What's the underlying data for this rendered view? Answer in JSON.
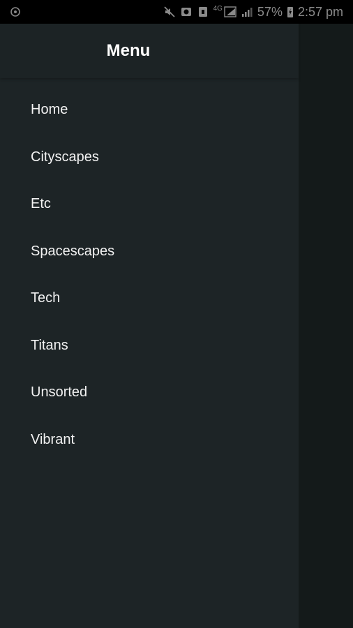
{
  "status_bar": {
    "lte_label": "4G",
    "battery_percent": "57%",
    "time": "2:57 pm",
    "icons": [
      "notification-icon",
      "mute-icon",
      "alarm-icon",
      "nfc-icon",
      "signal-icon",
      "wifi-signal-icon",
      "battery-charging-icon"
    ]
  },
  "drawer": {
    "title": "Menu",
    "items": [
      {
        "label": "Home"
      },
      {
        "label": "Cityscapes"
      },
      {
        "label": "Etc"
      },
      {
        "label": "Spacescapes"
      },
      {
        "label": "Tech"
      },
      {
        "label": "Titans"
      },
      {
        "label": "Unsorted"
      },
      {
        "label": "Vibrant"
      }
    ]
  },
  "colors": {
    "status_bar_bg": "#000000",
    "drawer_bg": "#1d2426",
    "scrim_bg": "#141a1a",
    "text": "#f2f2f2"
  }
}
